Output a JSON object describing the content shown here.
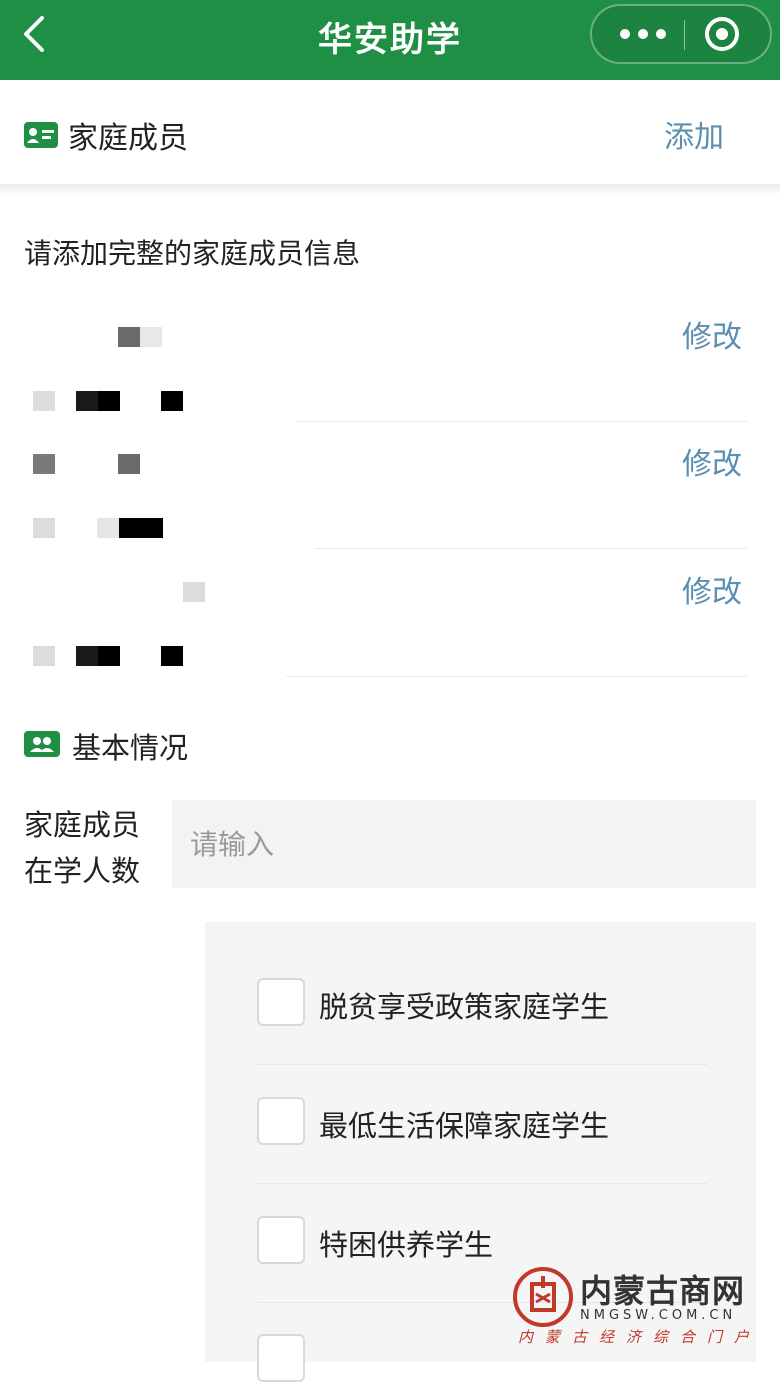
{
  "header": {
    "title": "华安助学",
    "bg_color": "#1f8f46",
    "back_icon": "chevron-left-icon",
    "more_icon": "more-dots-icon",
    "close_icon": "target-circle-icon"
  },
  "family_section": {
    "title": "家庭成员",
    "icon": "id-card-icon",
    "add_label": "添加",
    "hint": "请添加完整的家庭成员信息",
    "edit_label": "修改",
    "members": [
      {
        "edit_label": "修改"
      },
      {
        "edit_label": "修改"
      },
      {
        "edit_label": "修改"
      }
    ]
  },
  "basic_section": {
    "title": "基本情况",
    "icon": "people-icon",
    "students_label_line1": "家庭成员",
    "students_label_line2": "在学人数",
    "students_input": {
      "value": "",
      "placeholder": "请输入"
    },
    "options": [
      {
        "label": "脱贫享受政策家庭学生",
        "checked": false
      },
      {
        "label": "最低生活保障家庭学生",
        "checked": false
      },
      {
        "label": "特困供养学生",
        "checked": false
      }
    ]
  },
  "watermark": {
    "name": "内蒙古商网",
    "domain": "NMGSW.COM.CN",
    "slogan": "内蒙古经济综合门户"
  },
  "colors": {
    "accent_green": "#1f8f46",
    "link_blue": "#5a8fb0",
    "watermark_red": "#c0392b"
  }
}
